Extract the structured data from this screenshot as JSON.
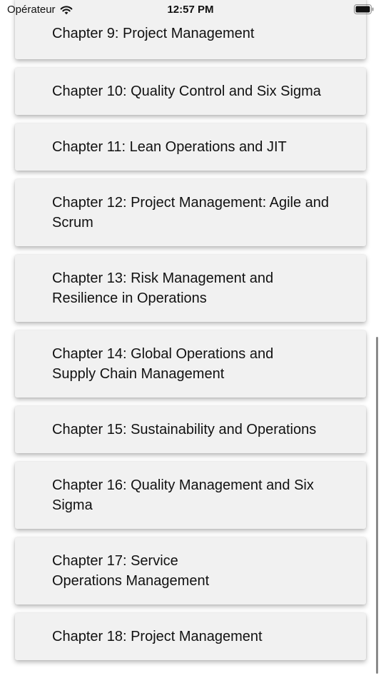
{
  "status_bar": {
    "carrier": "Opérateur",
    "time": "12:57 PM",
    "wifi_icon": "wifi-icon",
    "battery_icon": "battery-icon"
  },
  "chapters": [
    {
      "label": "Chapter 9: Project Management"
    },
    {
      "label": "Chapter 10: Quality Control and Six Sigma"
    },
    {
      "label": "Chapter 11: Lean Operations and JIT"
    },
    {
      "label": "Chapter 12: Project Management: Agile and Scrum"
    },
    {
      "label": "Chapter 13: Risk Management and Resilience in Operations"
    },
    {
      "label": "Chapter 14: Global Operations and Supply Chain Management"
    },
    {
      "label": "Chapter 15: Sustainability and Operations"
    },
    {
      "label": "Chapter 16: Quality Management and Six Sigma"
    },
    {
      "label": "Chapter 17: Service Operations Management"
    },
    {
      "label": "Chapter 18: Project Management"
    }
  ]
}
